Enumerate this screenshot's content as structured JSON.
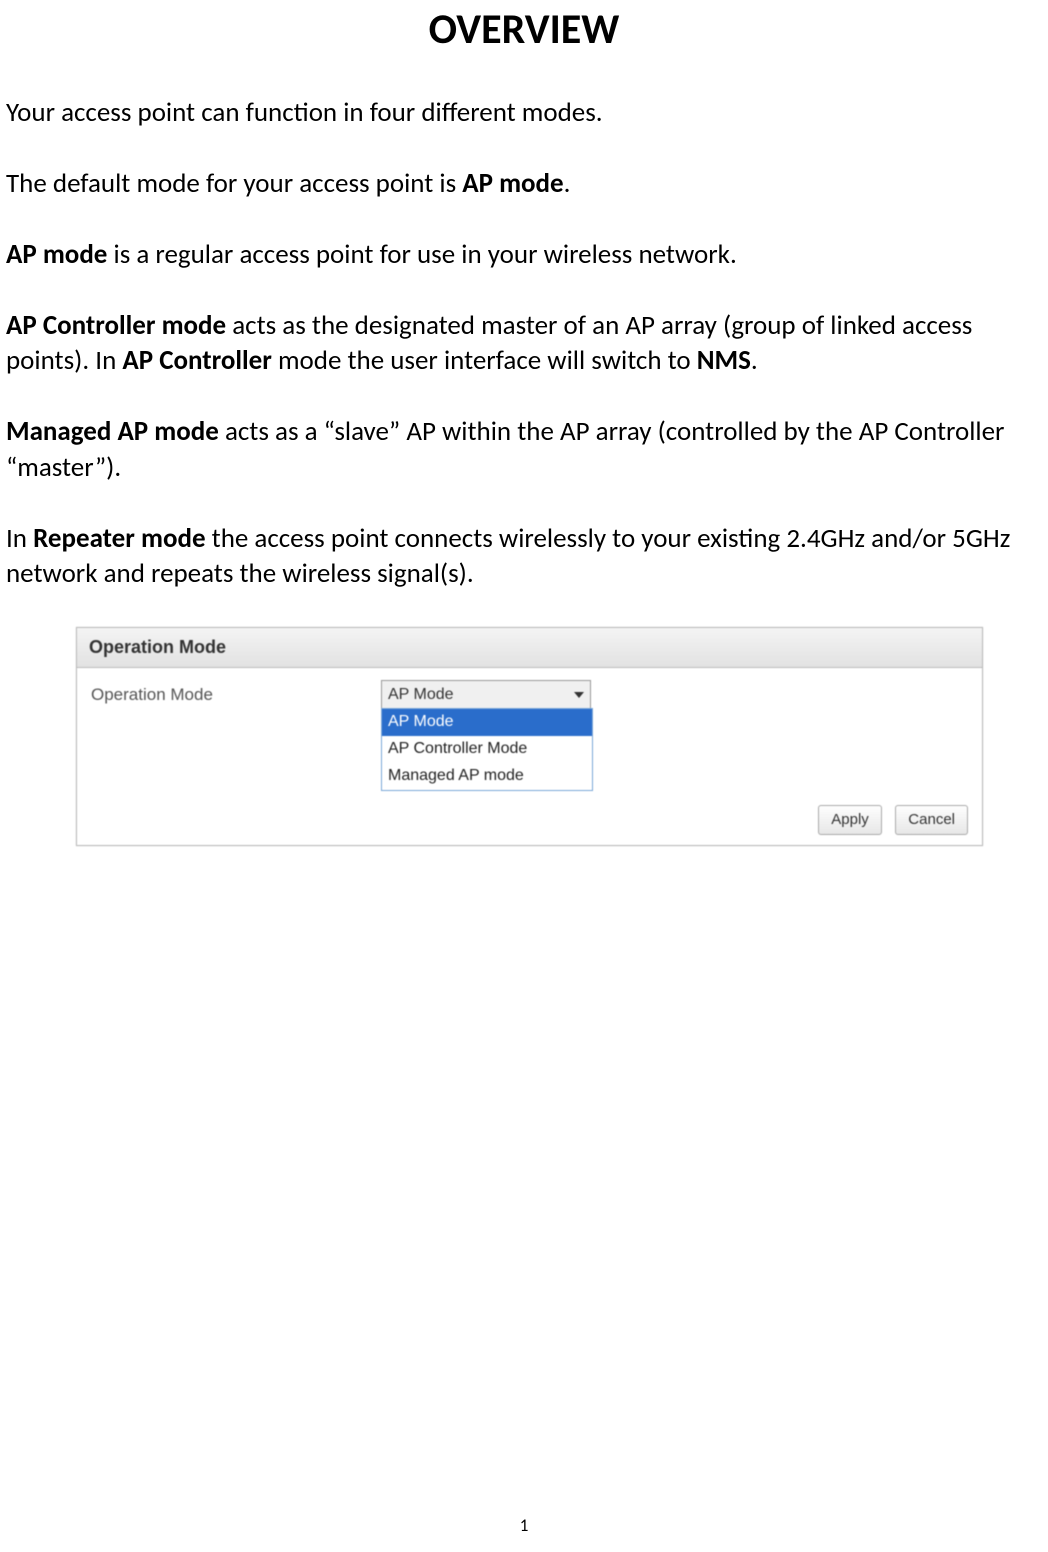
{
  "title": "OVERVIEW",
  "paragraphs": {
    "p1": "Your access point can function in four different modes.",
    "p2_a": "The default mode for your access point is ",
    "p2_b": "AP mode",
    "p2_c": ".",
    "p3_a": "AP mode",
    "p3_b": " is a regular access point for use in your wireless network.",
    "p4_a": "AP Controller mode",
    "p4_b": " acts as the designated master of an AP array (group of linked access points). In ",
    "p4_c": "AP Controller",
    "p4_d": " mode the user interface will switch to ",
    "p4_e": "NMS",
    "p4_f": ".",
    "p5_a": "Managed AP mode",
    "p5_b": " acts as a “slave” AP within the AP array (controlled by the AP Controller “master”).",
    "p6_a": "In ",
    "p6_b": "Repeater mode",
    "p6_c": " the access point connects wirelessly to your existing 2.4GHz and/or 5GHz network and repeats the wireless signal(s)."
  },
  "panel": {
    "header": "Operation Mode",
    "field_label": "Operation Mode",
    "selected": "AP Mode",
    "options": [
      "AP Mode",
      "AP Controller Mode",
      "Managed AP mode"
    ],
    "buttons": {
      "apply": "Apply",
      "cancel": "Cancel"
    }
  },
  "page_number": "1"
}
